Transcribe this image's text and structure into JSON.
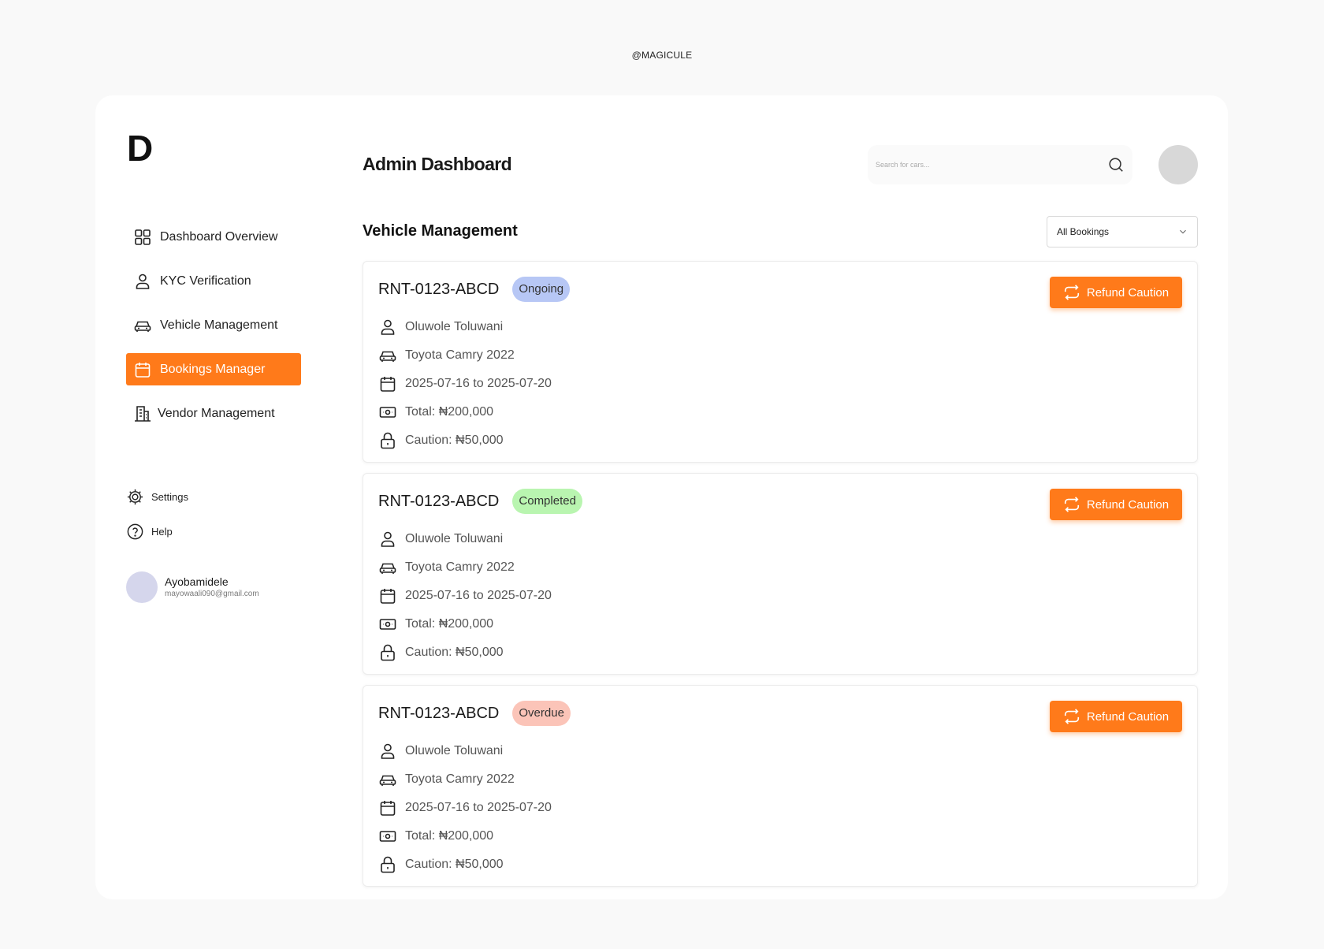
{
  "watermark": "@MAGICULE",
  "sidebar": {
    "logo": "D",
    "items": [
      {
        "label": "Dashboard Overview",
        "icon": "grid-icon"
      },
      {
        "label": "KYC Verification",
        "icon": "user-icon"
      },
      {
        "label": "Vehicle Management",
        "icon": "car-icon"
      },
      {
        "label": "Bookings Manager",
        "icon": "calendar-icon",
        "active": true
      },
      {
        "label": "Vendor Management",
        "icon": "building-icon"
      }
    ],
    "settings_label": "Settings",
    "help_label": "Help",
    "user": {
      "name": "Ayobamidele",
      "email": "mayowaali090@gmail.com"
    }
  },
  "header": {
    "title": "Admin Dashboard",
    "search_placeholder": "Search for cars..."
  },
  "section": {
    "title": "Vehicle Management",
    "filter_selected": "All Bookings"
  },
  "colors": {
    "accent": "#ff7a1a",
    "badge_ongoing": "#b7c7f5",
    "badge_completed": "#b9f5b0",
    "badge_overdue": "#fbc4b8"
  },
  "cards": [
    {
      "id": "RNT-0123-ABCD",
      "status": "Ongoing",
      "customer": "Oluwole Toluwani",
      "vehicle": "Toyota Camry 2022",
      "dates": "2025-07-16 to 2025-07-20",
      "total": "Total: ₦200,000",
      "caution": "Caution: ₦50,000",
      "action": "Refund Caution"
    },
    {
      "id": "RNT-0123-ABCD",
      "status": "Completed",
      "customer": "Oluwole Toluwani",
      "vehicle": "Toyota Camry 2022",
      "dates": "2025-07-16 to 2025-07-20",
      "total": "Total: ₦200,000",
      "caution": "Caution: ₦50,000",
      "action": "Refund Caution"
    },
    {
      "id": "RNT-0123-ABCD",
      "status": "Overdue",
      "customer": "Oluwole Toluwani",
      "vehicle": "Toyota Camry 2022",
      "dates": "2025-07-16 to 2025-07-20",
      "total": "Total: ₦200,000",
      "caution": "Caution: ₦50,000",
      "action": "Refund Caution"
    }
  ]
}
